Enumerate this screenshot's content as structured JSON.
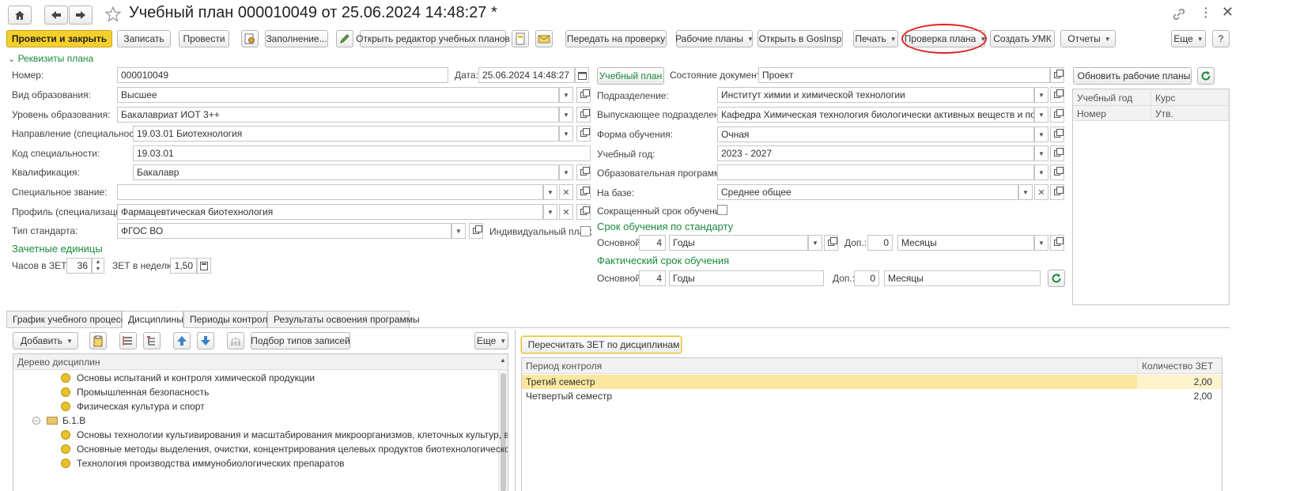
{
  "window": {
    "title": "Учебный план 000010049 от 25.06.2024 14:48:27 *"
  },
  "toolbar": {
    "post_close": "Провести и закрыть",
    "save": "Записать",
    "post": "Провести",
    "fill": "Заполнение...",
    "open_editor": "Открыть редактор учебных планов",
    "send_check": "Передать на проверку",
    "work_plans": "Рабочие планы",
    "open_gosinsp": "Открыть в GosInsp",
    "print": "Печать",
    "check_plan": "Проверка плана",
    "create_umk": "Создать УМК",
    "reports": "Отчеты",
    "more": "Еще",
    "help": "?"
  },
  "requisites": {
    "toggle_label": "Реквизиты плана",
    "number_label": "Номер:",
    "number_value": "000010049",
    "date_label": "Дата:",
    "date_value": "25.06.2024 14:48:27",
    "edu_type_label": "Вид образования:",
    "edu_type_value": "Высшее",
    "edu_level_label": "Уровень образования:",
    "edu_level_value": "Бакалавриат ИОТ 3++",
    "direction_label": "Направление (специальность):",
    "direction_value": "19.03.01 Биотехнология",
    "spec_code_label": "Код специальности:",
    "spec_code_value": "19.03.01",
    "qualification_label": "Квалификация:",
    "qualification_value": "Бакалавр",
    "special_title_label": "Специальное звание:",
    "special_title_value": "",
    "profile_label": "Профиль (специализация):",
    "profile_value": "Фармацевтическая биотехнология",
    "standard_type_label": "Тип стандарта:",
    "standard_type_value": "ФГОС ВО",
    "individual_plan_label": "Индивидуальный план:",
    "credit_units_title": "Зачетные единицы",
    "hours_per_zet_label": "Часов в ЗЕТ:",
    "hours_per_zet_value": "36",
    "zet_per_week_label": "ЗЕТ в неделю:",
    "zet_per_week_value": "1,50"
  },
  "middle": {
    "study_plan_button": "Учебный план",
    "doc_state_label": "Состояние документа:",
    "doc_state_value": "Проект",
    "division_label": "Подразделение:",
    "division_value": "Институт химии и химической технологии",
    "graduating_division_label": "Выпускающее подразделение:",
    "graduating_division_value": "Кафедра Химическая технология биологически активных веществ и полимерных",
    "study_form_label": "Форма обучения:",
    "study_form_value": "Очная",
    "study_year_label": "Учебный год:",
    "study_year_value": "2023 - 2027",
    "edu_program_label": "Образовательная программа:",
    "edu_program_value": "",
    "basis_label": "На базе:",
    "basis_value": "Среднее общее",
    "shortened_label": "Сокращенный срок обучения:",
    "standard_term_title": "Срок обучения по стандарту",
    "main_label": "Основной:",
    "std_main_value": "4",
    "std_main_unit": "Годы",
    "extra_label": "Доп.:",
    "std_extra_value": "0",
    "std_extra_unit": "Месяцы",
    "actual_term_title": "Фактический срок обучения",
    "act_main_value": "4",
    "act_main_unit": "Годы",
    "act_extra_value": "0",
    "act_extra_unit": "Месяцы"
  },
  "right_panel": {
    "update_work_plans": "Обновить рабочие планы",
    "col_study_year": "Учебный год",
    "col_course": "Курс",
    "col_number": "Номер",
    "col_approved": "Утв."
  },
  "tabs": [
    "График учебного процесса",
    "Дисциплины",
    "Периоды контроля",
    "Результаты освоения программы"
  ],
  "disciplines": {
    "add": "Добавить",
    "pick_types": "Подбор типов записей",
    "more": "Еще",
    "tree_header": "Дерево дисциплин",
    "rows": [
      {
        "kind": "item",
        "text": "Основы испытаний и контроля химической продукции"
      },
      {
        "kind": "item",
        "text": "Промышленная безопасность"
      },
      {
        "kind": "item",
        "text": "Физическая культура и спорт"
      },
      {
        "kind": "folder",
        "text": "Б.1.В"
      },
      {
        "kind": "item",
        "text": "Основы технологии культивирования и масштабирования микроорганизмов, клеточных культур, вирусов"
      },
      {
        "kind": "item",
        "text": "Основные методы выделения, очистки, концентрирования целевых продуктов биотехнологического производ"
      },
      {
        "kind": "item",
        "text": "Технология производства иммунобиологических препаратов"
      }
    ]
  },
  "periods": {
    "recalc": "Пересчитать ЗЕТ по дисциплинам",
    "col_period": "Период контроля",
    "col_zet": "Количество ЗЕТ",
    "rows": [
      {
        "period": "Третий семестр",
        "zet": "2,00"
      },
      {
        "period": "Четвертый семестр",
        "zet": "2,00"
      }
    ]
  },
  "colors": {
    "accent_yellow": "#f5d02c",
    "green": "#1a8a3c",
    "highlight_row": "#fbe7a0",
    "annotation_red": "#e02020"
  }
}
